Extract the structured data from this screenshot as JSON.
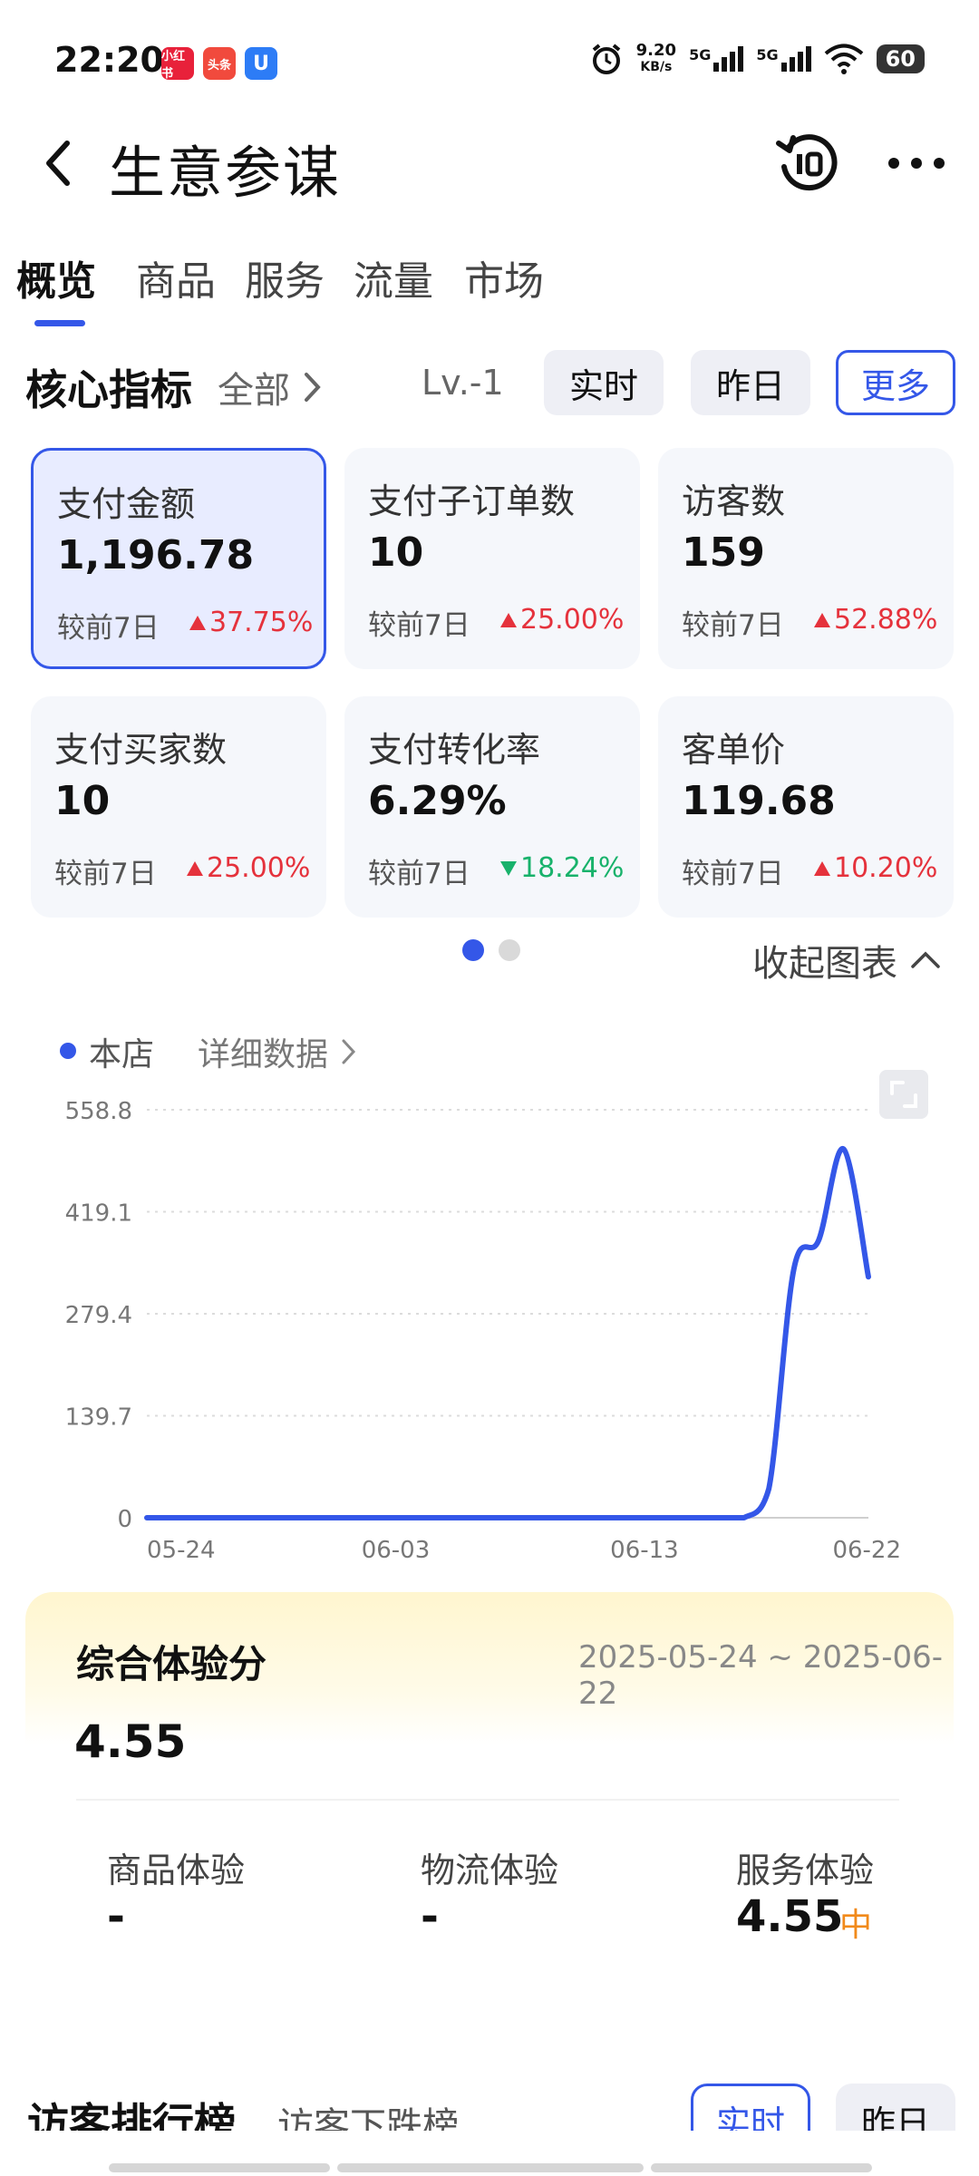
{
  "status": {
    "time": "22:20",
    "apps": [
      {
        "text": "小红书",
        "color": "#e8213a"
      },
      {
        "text": "头条",
        "color": "#f14a3d"
      },
      {
        "text": "U",
        "color": "#2d7cf6"
      }
    ],
    "net_speed": "9.20",
    "net_unit": "KB/s",
    "sig1": "5G",
    "sig2": "5G",
    "battery": "60"
  },
  "header": {
    "title": "生意参谋"
  },
  "tabs": [
    {
      "label": "概览"
    },
    {
      "label": "商品"
    },
    {
      "label": "服务"
    },
    {
      "label": "流量"
    },
    {
      "label": "市场"
    }
  ],
  "core": {
    "title": "核心指标",
    "scope": "全部",
    "level": "Lv.-1",
    "range_buttons": [
      "实时",
      "昨日",
      "更多"
    ]
  },
  "metrics": [
    {
      "label": "支付金额",
      "value": "1,196.78",
      "compare": "较前7日",
      "delta": "37.75%",
      "dir": "up"
    },
    {
      "label": "支付子订单数",
      "value": "10",
      "compare": "较前7日",
      "delta": "25.00%",
      "dir": "up"
    },
    {
      "label": "访客数",
      "value": "159",
      "compare": "较前7日",
      "delta": "52.88%",
      "dir": "up"
    },
    {
      "label": "支付买家数",
      "value": "10",
      "compare": "较前7日",
      "delta": "25.00%",
      "dir": "up"
    },
    {
      "label": "支付转化率",
      "value": "6.29%",
      "compare": "较前7日",
      "delta": "18.24%",
      "dir": "down"
    },
    {
      "label": "客单价",
      "value": "119.68",
      "compare": "较前7日",
      "delta": "10.20%",
      "dir": "up"
    }
  ],
  "collapse_label": "收起图表",
  "chart_legend": "本店",
  "detail_link": "详细数据",
  "chart_data": {
    "type": "line",
    "series": [
      {
        "name": "本店",
        "color": "#3457e8"
      }
    ],
    "x": [
      "05-24",
      "05-25",
      "05-26",
      "05-27",
      "05-28",
      "05-29",
      "05-30",
      "05-31",
      "06-01",
      "06-02",
      "06-03",
      "06-04",
      "06-05",
      "06-06",
      "06-07",
      "06-08",
      "06-09",
      "06-10",
      "06-11",
      "06-12",
      "06-13",
      "06-14",
      "06-15",
      "06-16",
      "06-17",
      "06-18",
      "06-19",
      "06-20",
      "06-21",
      "06-22"
    ],
    "values": [
      0,
      0,
      0,
      0,
      0,
      0,
      0,
      0,
      0,
      0,
      0,
      0,
      0,
      0,
      0,
      0,
      0,
      0,
      0,
      0,
      0,
      0,
      0,
      0,
      0,
      40,
      340,
      380,
      505,
      330
    ],
    "x_ticks": [
      "05-24",
      "06-03",
      "06-13",
      "06-22"
    ],
    "y_ticks": [
      "558.8",
      "419.1",
      "279.4",
      "139.7",
      "0"
    ],
    "ylim": [
      0,
      558.8
    ],
    "grid": true
  },
  "experience": {
    "title": "综合体验分",
    "date_range": "2025-05-24 ~ 2025-06-22",
    "score": "4.55",
    "items": [
      {
        "label": "商品体验",
        "value": "-"
      },
      {
        "label": "物流体验",
        "value": "-"
      },
      {
        "label": "服务体验",
        "value": "4.55",
        "tag": "中"
      }
    ]
  },
  "rank": {
    "title": "访客排行榜",
    "sub": "访客下跌榜",
    "buttons": [
      "实时",
      "昨日"
    ]
  }
}
